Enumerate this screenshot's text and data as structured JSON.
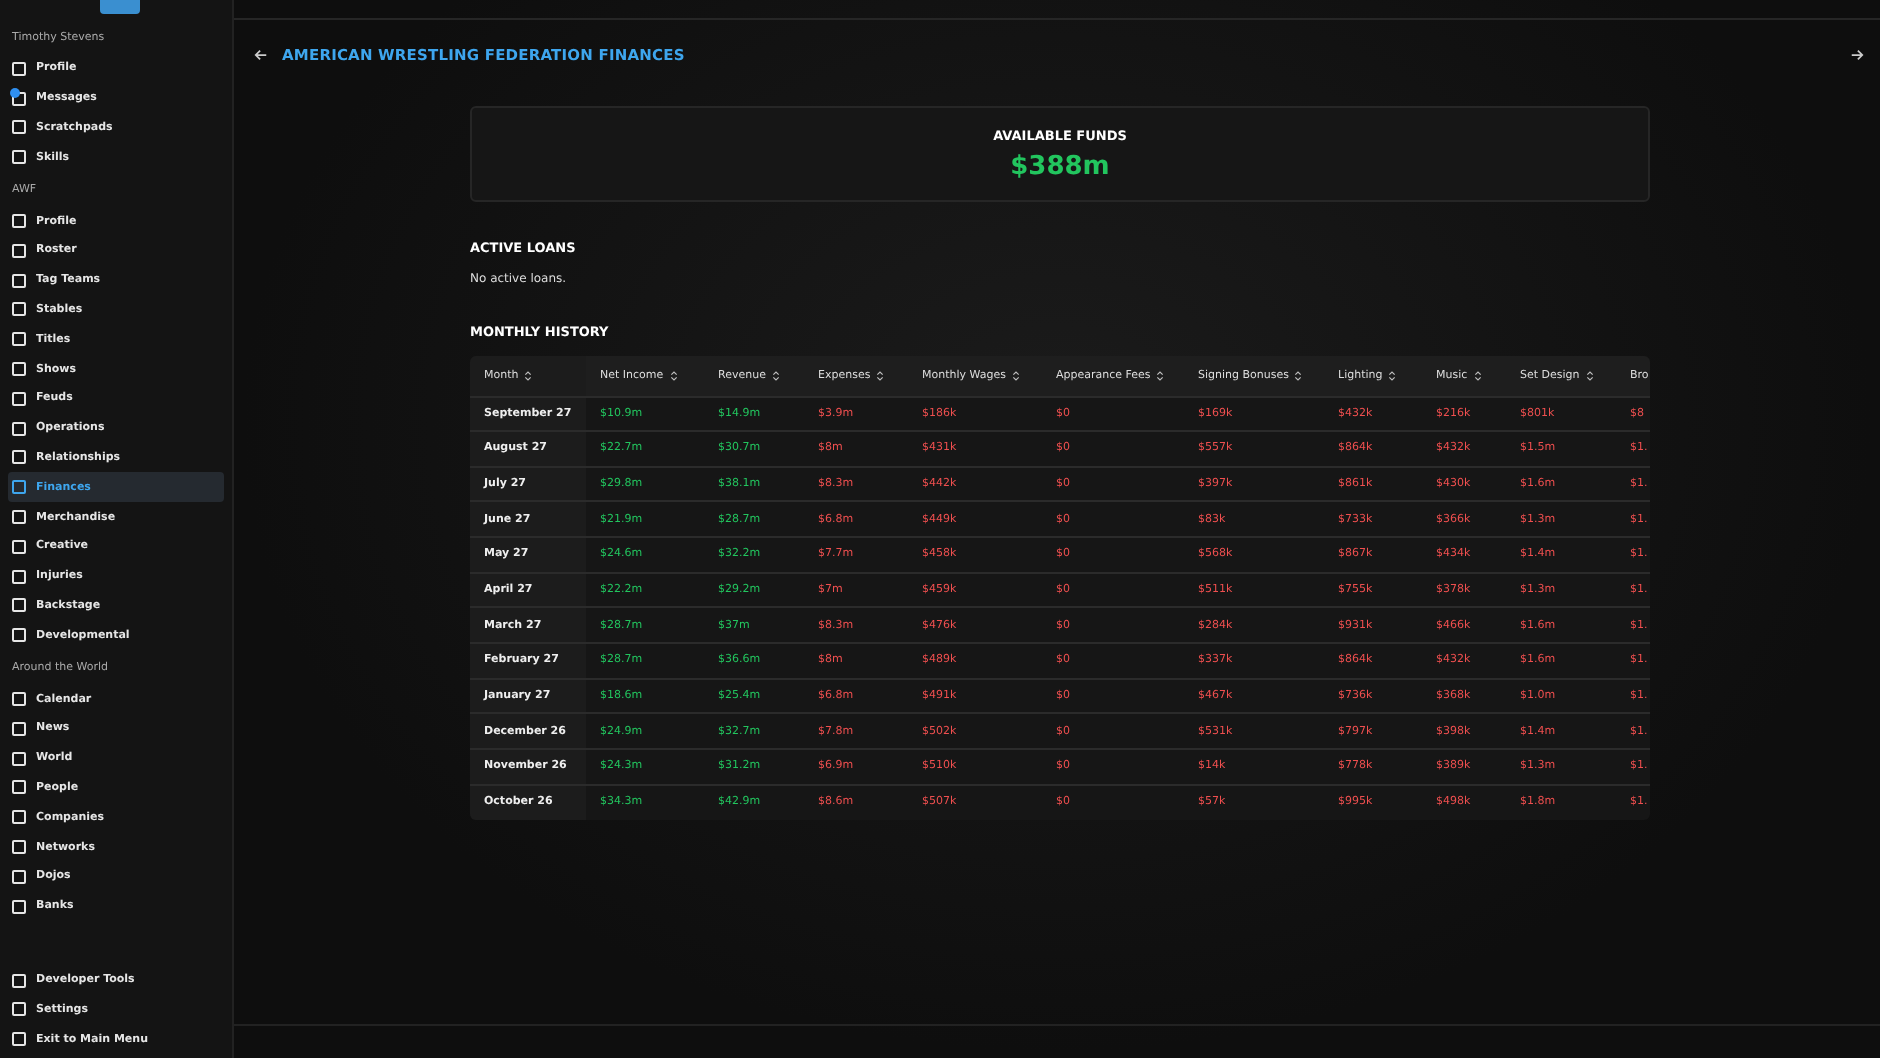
{
  "sidebar": {
    "groups": [
      {
        "title": "Timothy Stevens",
        "items": [
          {
            "label": "Profile",
            "selected": false,
            "unread": false
          },
          {
            "label": "Messages",
            "selected": false,
            "unread": true
          },
          {
            "label": "Scratchpads",
            "selected": false,
            "unread": false
          },
          {
            "label": "Skills",
            "selected": false,
            "unread": false
          }
        ]
      },
      {
        "title": "AWF",
        "items": [
          {
            "label": "Profile",
            "selected": false,
            "unread": false
          },
          {
            "label": "Roster",
            "selected": false,
            "unread": false
          },
          {
            "label": "Tag Teams",
            "selected": false,
            "unread": false
          },
          {
            "label": "Stables",
            "selected": false,
            "unread": false
          },
          {
            "label": "Titles",
            "selected": false,
            "unread": false
          },
          {
            "label": "Shows",
            "selected": false,
            "unread": false
          },
          {
            "label": "Feuds",
            "selected": false,
            "unread": false
          },
          {
            "label": "Operations",
            "selected": false,
            "unread": false
          },
          {
            "label": "Relationships",
            "selected": false,
            "unread": false
          },
          {
            "label": "Finances",
            "selected": true,
            "unread": false
          },
          {
            "label": "Merchandise",
            "selected": false,
            "unread": false
          },
          {
            "label": "Creative",
            "selected": false,
            "unread": false
          },
          {
            "label": "Injuries",
            "selected": false,
            "unread": false
          },
          {
            "label": "Backstage",
            "selected": false,
            "unread": false
          },
          {
            "label": "Developmental",
            "selected": false,
            "unread": false
          }
        ]
      },
      {
        "title": "Around the World",
        "items": [
          {
            "label": "Calendar",
            "selected": false,
            "unread": false
          },
          {
            "label": "News",
            "selected": false,
            "unread": false
          },
          {
            "label": "World",
            "selected": false,
            "unread": false
          },
          {
            "label": "People",
            "selected": false,
            "unread": false
          },
          {
            "label": "Companies",
            "selected": false,
            "unread": false
          },
          {
            "label": "Networks",
            "selected": false,
            "unread": false
          },
          {
            "label": "Dojos",
            "selected": false,
            "unread": false
          },
          {
            "label": "Banks",
            "selected": false,
            "unread": false
          }
        ]
      },
      {
        "items": [
          {
            "label": "Developer Tools",
            "selected": false,
            "unread": false
          },
          {
            "label": "Settings",
            "selected": false,
            "unread": false
          },
          {
            "label": "Exit to Main Menu",
            "selected": false,
            "unread": false
          }
        ]
      }
    ]
  },
  "page_title": "AMERICAN WRESTLING FEDERATION FINANCES",
  "funds": {
    "label": "AVAILABLE FUNDS",
    "value": "$388m"
  },
  "active_loans": {
    "heading": "ACTIVE LOANS",
    "empty_text": "No active loans."
  },
  "history": {
    "heading": "MONTHLY HISTORY",
    "columns": [
      {
        "label": "Month",
        "kind": "label"
      },
      {
        "label": "Net Income",
        "kind": "gain"
      },
      {
        "label": "Revenue",
        "kind": "gain"
      },
      {
        "label": "Expenses",
        "kind": "cost"
      },
      {
        "label": "Monthly Wages",
        "kind": "cost"
      },
      {
        "label": "Appearance Fees",
        "kind": "cost"
      },
      {
        "label": "Signing Bonuses",
        "kind": "cost"
      },
      {
        "label": "Lighting",
        "kind": "cost"
      },
      {
        "label": "Music",
        "kind": "cost"
      },
      {
        "label": "Set Design",
        "kind": "cost"
      },
      {
        "label": "Bro",
        "kind": "cost"
      }
    ],
    "rows": [
      [
        "September 27",
        "$10.9m",
        "$14.9m",
        "$3.9m",
        "$186k",
        "$0",
        "$169k",
        "$432k",
        "$216k",
        "$801k",
        "$8"
      ],
      [
        "August 27",
        "$22.7m",
        "$30.7m",
        "$8m",
        "$431k",
        "$0",
        "$557k",
        "$864k",
        "$432k",
        "$1.5m",
        "$1."
      ],
      [
        "July 27",
        "$29.8m",
        "$38.1m",
        "$8.3m",
        "$442k",
        "$0",
        "$397k",
        "$861k",
        "$430k",
        "$1.6m",
        "$1."
      ],
      [
        "June 27",
        "$21.9m",
        "$28.7m",
        "$6.8m",
        "$449k",
        "$0",
        "$83k",
        "$733k",
        "$366k",
        "$1.3m",
        "$1."
      ],
      [
        "May 27",
        "$24.6m",
        "$32.2m",
        "$7.7m",
        "$458k",
        "$0",
        "$568k",
        "$867k",
        "$434k",
        "$1.4m",
        "$1."
      ],
      [
        "April 27",
        "$22.2m",
        "$29.2m",
        "$7m",
        "$459k",
        "$0",
        "$511k",
        "$755k",
        "$378k",
        "$1.3m",
        "$1."
      ],
      [
        "March 27",
        "$28.7m",
        "$37m",
        "$8.3m",
        "$476k",
        "$0",
        "$284k",
        "$931k",
        "$466k",
        "$1.6m",
        "$1."
      ],
      [
        "February 27",
        "$28.7m",
        "$36.6m",
        "$8m",
        "$489k",
        "$0",
        "$337k",
        "$864k",
        "$432k",
        "$1.6m",
        "$1."
      ],
      [
        "January 27",
        "$18.6m",
        "$25.4m",
        "$6.8m",
        "$491k",
        "$0",
        "$467k",
        "$736k",
        "$368k",
        "$1.0m",
        "$1."
      ],
      [
        "December 26",
        "$24.9m",
        "$32.7m",
        "$7.8m",
        "$502k",
        "$0",
        "$531k",
        "$797k",
        "$398k",
        "$1.4m",
        "$1."
      ],
      [
        "November 26",
        "$24.3m",
        "$31.2m",
        "$6.9m",
        "$510k",
        "$0",
        "$14k",
        "$778k",
        "$389k",
        "$1.3m",
        "$1."
      ],
      [
        "October 26",
        "$34.3m",
        "$42.9m",
        "$8.6m",
        "$507k",
        "$0",
        "$57k",
        "$995k",
        "$498k",
        "$1.8m",
        "$1."
      ]
    ]
  }
}
